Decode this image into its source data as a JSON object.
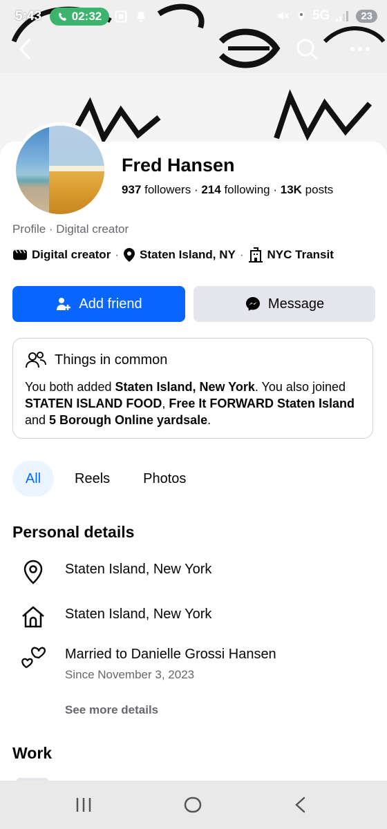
{
  "status_bar": {
    "time": "5:43",
    "call_timer": "02:32",
    "network": "5G",
    "battery": "23"
  },
  "profile": {
    "name": "Fred Hansen",
    "followers_count": "937",
    "followers_label": "followers",
    "following_count": "214",
    "following_label": "following",
    "posts_count": "13K",
    "posts_label": "posts",
    "separator": "·",
    "subline": "Profile · Digital creator",
    "tags": [
      {
        "label": "Digital creator",
        "icon": "video-icon"
      },
      {
        "label": "Staten Island, NY",
        "icon": "location-pin-icon"
      },
      {
        "label": "NYC Transit",
        "icon": "building-icon"
      }
    ]
  },
  "actions": {
    "add_friend": "Add friend",
    "message": "Message"
  },
  "things_in_common": {
    "title": "Things in common",
    "t1": "You both added ",
    "b1": "Staten Island, New York",
    "t2": ". You also joined ",
    "b2": "STATEN ISLAND FOOD",
    "t3": ", ",
    "b3": "Free It FORWARD Staten Island",
    "t4": " and ",
    "b4": "5 Borough Online yardsale",
    "t5": "."
  },
  "tabs": [
    {
      "label": "All",
      "selected": true
    },
    {
      "label": "Reels",
      "selected": false
    },
    {
      "label": "Photos",
      "selected": false
    }
  ],
  "personal_details": {
    "title": "Personal details",
    "items": [
      {
        "icon": "location-pin-icon",
        "text": "Staten Island, New York"
      },
      {
        "icon": "home-icon",
        "text": "Staten Island, New York"
      },
      {
        "icon": "hearts-icon",
        "text": "Married to Danielle Grossi Hansen",
        "sub": "Since November 3, 2023"
      }
    ],
    "see_more": "See more details"
  },
  "work": {
    "title": "Work"
  },
  "colors": {
    "primary_blue": "#0866ff",
    "secondary_gray": "#e4e6eb",
    "muted_text": "#65676b"
  }
}
